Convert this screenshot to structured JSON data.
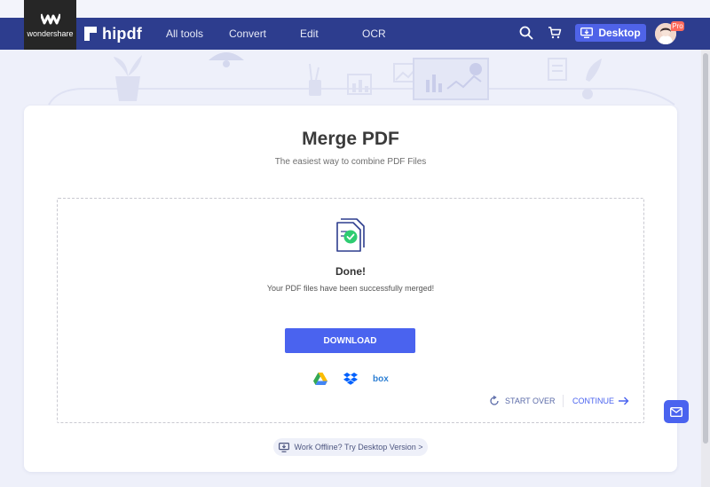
{
  "brand": {
    "wondershare": "wondershare",
    "hipdf": "hipdf"
  },
  "nav": {
    "all_tools": "All tools",
    "convert": "Convert",
    "edit": "Edit",
    "ocr": "OCR"
  },
  "header": {
    "desktop_label": "Desktop",
    "pro_badge": "Pro",
    "search_icon": "search-icon",
    "cart_icon": "cart-icon"
  },
  "main": {
    "title": "Merge PDF",
    "subtitle": "The easiest way to combine PDF Files",
    "status_title": "Done!",
    "status_text": "Your PDF files have been successfully merged!",
    "download_label": "DOWNLOAD",
    "cloud_services": [
      "google-drive-icon",
      "dropbox-icon",
      "box"
    ],
    "box_label": "box",
    "start_over_label": "START OVER",
    "continue_label": "CONTINUE",
    "offline_label": "Work Offline? Try Desktop Version >"
  },
  "colors": {
    "nav_bg": "#2d3d8e",
    "accent": "#4a63ef",
    "success": "#2ecc71",
    "page_bg": "#eef0fa"
  }
}
